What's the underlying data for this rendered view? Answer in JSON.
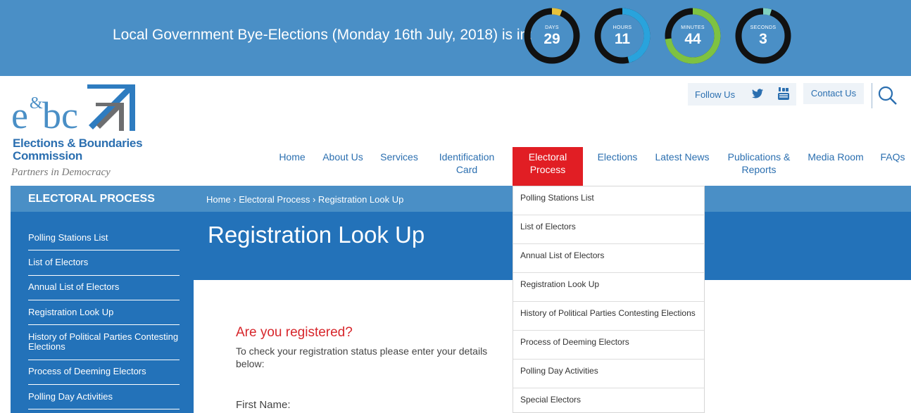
{
  "banner": {
    "text": "Local Government Bye-Elections (Monday 16th July, 2018) is in:",
    "timers": [
      {
        "label": "DAYS",
        "value": "29",
        "progress": 0.06,
        "color": "#e8c23a"
      },
      {
        "label": "HOURS",
        "value": "11",
        "progress": 0.46,
        "color": "#29a3dc"
      },
      {
        "label": "MINUTES",
        "value": "44",
        "progress": 0.73,
        "color": "#7ec242"
      },
      {
        "label": "SECONDS",
        "value": "3",
        "progress": 0.05,
        "color": "#7fd1c0"
      }
    ]
  },
  "logo": {
    "line1": "Elections & Boundaries",
    "line2": "Commission",
    "tagline": "Partners in Democracy"
  },
  "social": {
    "follow_label": "Follow Us",
    "twitter_icon": "twitter-icon",
    "youtube_icon": "youtube-icon"
  },
  "contact_label": "Contact Us",
  "nav": [
    "Home",
    "About Us",
    "Services",
    "Identification Card",
    "Electoral Process",
    "Elections",
    "Latest News",
    "Publications & Reports",
    "Media Room",
    "FAQs"
  ],
  "sidebar": {
    "title": "ELECTORAL PROCESS",
    "items": [
      "Polling Stations List",
      "List of Electors",
      "Annual List of Electors",
      "Registration Look Up",
      "History of Political Parties Contesting Elections",
      "Process of Deeming Electors",
      "Polling Day Activities"
    ]
  },
  "breadcrumb": "Home › Electoral Process › Registration Look Up",
  "page_title": "Registration Look Up",
  "form": {
    "question": "Are you registered?",
    "instructions": "To check your registration status please enter your details below:",
    "first_name_label": "First Name:"
  },
  "dropdown": {
    "items": [
      "Polling Stations List",
      "List of Electors",
      "Annual List of Electors",
      "Registration Look Up",
      "History of Political Parties Contesting Elections",
      "Process of Deeming Electors",
      "Polling Day Activities",
      "Special Electors"
    ]
  },
  "colors": {
    "banner": "#4a8fc6",
    "primary": "#2372b9",
    "accent": "#e11e24",
    "heading_red": "#d7262b"
  }
}
